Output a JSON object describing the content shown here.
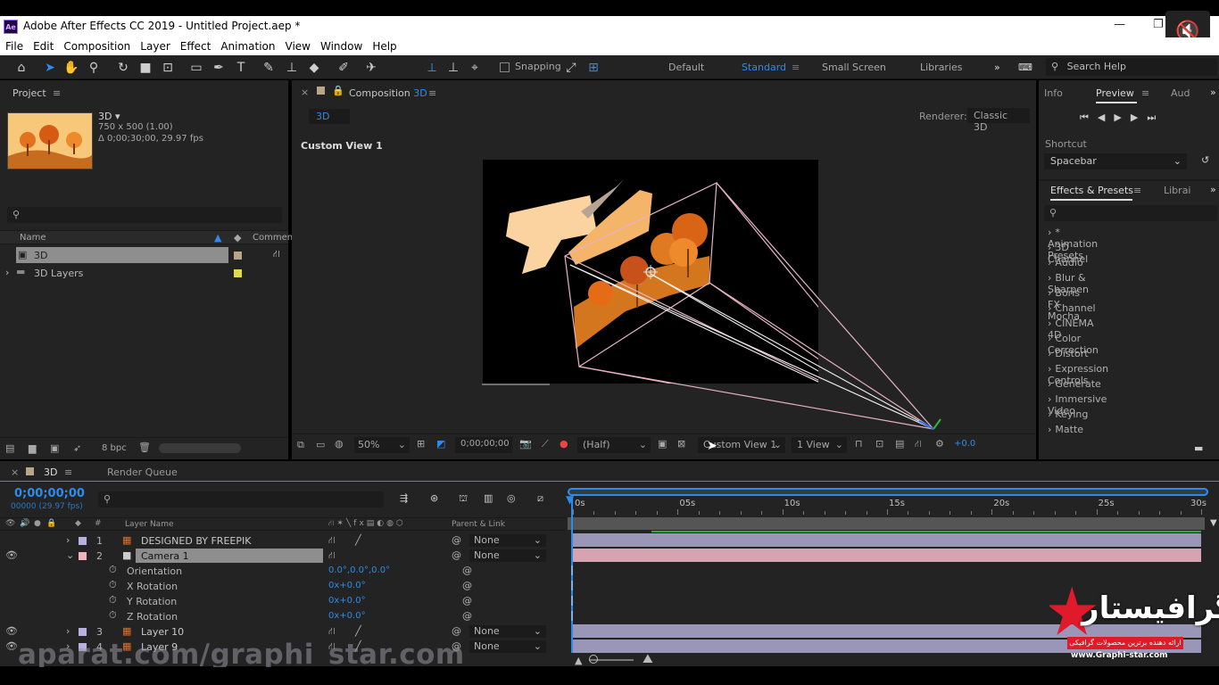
{
  "titlebar": {
    "title": "Adobe After Effects CC 2019 - Untitled Project.aep *",
    "app_icon": "Ae"
  },
  "menu": [
    "File",
    "Edit",
    "Composition",
    "Layer",
    "Effect",
    "Animation",
    "View",
    "Window",
    "Help"
  ],
  "toolbar": {
    "snapping_label": "Snapping",
    "workspaces": [
      "Default",
      "Standard",
      "Small Screen",
      "Libraries"
    ],
    "active_workspace": "Standard",
    "search_placeholder": "Search Help"
  },
  "project": {
    "tab": "Project",
    "item_name": "3D",
    "item_size": "750 x 500 (1.00)",
    "item_duration": "Δ 0;00;30;00, 29.97 fps",
    "columns": {
      "name": "Name",
      "comment": "Comment"
    },
    "rows": [
      {
        "name": "3D",
        "type": "composition",
        "label_color": "#b9a58a"
      },
      {
        "name": "3D Layers",
        "type": "folder",
        "label_color": "#e4d84c"
      }
    ],
    "bpc": "8 bpc"
  },
  "composition": {
    "tab_prefix": "Composition",
    "tab_name": "3D",
    "breadcrumb": "3D",
    "renderer_label": "Renderer:",
    "renderer_value": "Classic 3D",
    "view_label": "Custom View 1",
    "zoom": "50%",
    "timecode": "0;00;00;00",
    "resolution": "(Half)",
    "view_select": "Custom View 1",
    "view_count": "1 View",
    "exposure": "+0.0"
  },
  "right": {
    "tabs": [
      "Info",
      "Preview",
      "Aud"
    ],
    "active_tab": "Preview",
    "shortcut_label": "Shortcut",
    "shortcut_value": "Spacebar",
    "effects_tab": "Effects & Presets",
    "effects_tab2": "Librai",
    "effects": [
      "* Animation Presets",
      "3D Channel",
      "Audio",
      "Blur & Sharpen",
      "Boris FX Mocha",
      "Channel",
      "CINEMA 4D",
      "Color Correction",
      "Distort",
      "Expression Controls",
      "Generate",
      "Immersive Video",
      "Keying",
      "Matte"
    ]
  },
  "timeline": {
    "tab": "3D",
    "render_queue": "Render Queue",
    "timecode": "0;00;00;00",
    "fps": "00000 (29.97 fps)",
    "col_layer_name": "Layer Name",
    "col_parent": "Parent & Link",
    "ruler": [
      "0s",
      "05s",
      "10s",
      "15s",
      "20s",
      "25s",
      "30s"
    ],
    "layers": [
      {
        "num": "1",
        "name": "DESIGNED BY FREEPIK",
        "parent": "None",
        "label_color": "#b8b0e0"
      },
      {
        "num": "2",
        "name": "Camera 1",
        "parent": "None",
        "label_color": "#f0b4c0",
        "selected": true
      },
      {
        "num": "3",
        "name": "Layer 10",
        "parent": "None",
        "label_color": "#b8b0e0"
      },
      {
        "num": "4",
        "name": "Layer 9",
        "parent": "None",
        "label_color": "#b8b0e0"
      }
    ],
    "properties": [
      {
        "name": "Orientation",
        "value": "0.0°,0.0°,0.0°"
      },
      {
        "name": "X Rotation",
        "value": "0x+0.0°"
      },
      {
        "name": "Y Rotation",
        "value": "0x+0.0°"
      },
      {
        "name": "Z Rotation",
        "value": "0x+0.0°"
      }
    ]
  },
  "overlay": {
    "watermark": "aparat.com/graphi_star.com",
    "logo_text": "گرافیستار",
    "logo_sub": "ارائه دهنده برترین محصولات گرافیکی",
    "logo_url": "www.Graphi-star.com"
  },
  "colors": {
    "accent": "#2d8ceb",
    "panel": "#232323",
    "track_pink": "#d6a3b0",
    "track_purple": "#9a96b8"
  }
}
